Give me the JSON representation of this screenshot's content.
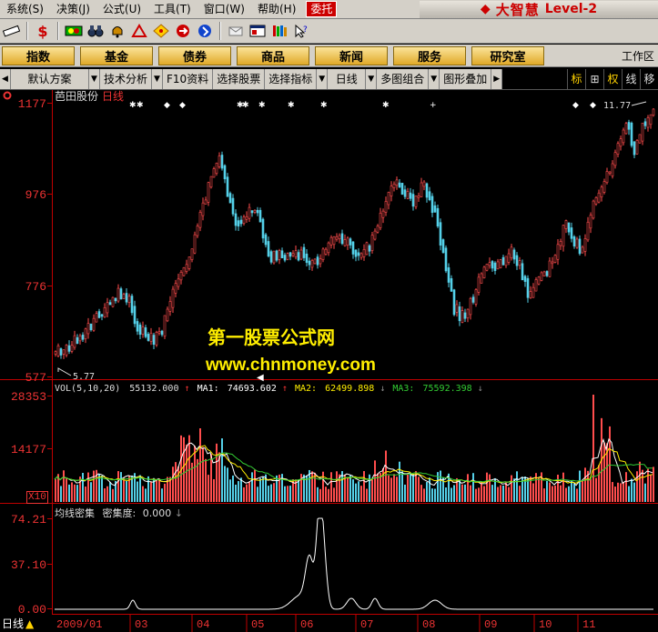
{
  "menubar": {
    "items": [
      "系统(S)",
      "决策(J)",
      "公式(U)",
      "工具(T)",
      "窗口(W)",
      "帮助(H)"
    ],
    "trust_label": "委托",
    "brand_logo": "◆",
    "brand_name": "大智慧",
    "brand_level": "Level-2"
  },
  "toolbar": {
    "icons": [
      "pencil-icon",
      "dollar-icon",
      "indicator-icon",
      "binoculars-icon",
      "alarm-bell-icon",
      "drafting-icon",
      "diamond-icon",
      "arrow-icon",
      "push-pin-icon",
      "message-icon",
      "window-icon",
      "books-icon",
      "help-pointer-icon"
    ]
  },
  "navbar": {
    "buttons": [
      "指数",
      "基金",
      "债券",
      "商品",
      "新闻",
      "服务",
      "研究室"
    ],
    "workspace_label": "工作区"
  },
  "tabbar": {
    "tabs": [
      "默认方案",
      "技术分析",
      "F10资料",
      "选择股票",
      "选择指标",
      "日线",
      "多图组合",
      "图形叠加"
    ],
    "tools": [
      "标",
      "⊞",
      "权",
      "线",
      "移"
    ]
  },
  "stock": {
    "name": "芭田股份",
    "period": "日线"
  },
  "main_panel": {
    "y_ticks": [
      "1177",
      "976",
      "776",
      "577"
    ],
    "high_marker": "11.77",
    "low_marker": "5.77"
  },
  "volume_panel": {
    "info": {
      "label": "VOL(5,10,20)",
      "vol": "55132.000",
      "ma1_label": "MA1:",
      "ma1": "74693.602",
      "ma2_label": "MA2:",
      "ma2": "62499.898",
      "ma3_label": "MA3:",
      "ma3": "75592.398"
    },
    "y_ticks": [
      "28353",
      "14177"
    ],
    "unit": "X10"
  },
  "indicator_panel": {
    "name": "均线密集",
    "label": "密集度:",
    "value": "0.000",
    "y_ticks": [
      "74.21",
      "37.10",
      "0.00"
    ]
  },
  "x_axis": {
    "labels": [
      "2009/01",
      "03",
      "04",
      "05",
      "06",
      "07",
      "08",
      "09",
      "10",
      "11"
    ]
  },
  "watermark": {
    "line1": "第一股票公式网",
    "line2": "www.chnmoney.com"
  },
  "colors": {
    "up": "#ff4d4d",
    "down": "#54d0e8",
    "ma1": "#ffffff",
    "ma2": "#ffee00",
    "ma3": "#33cc33",
    "axis": "#c00000"
  }
}
